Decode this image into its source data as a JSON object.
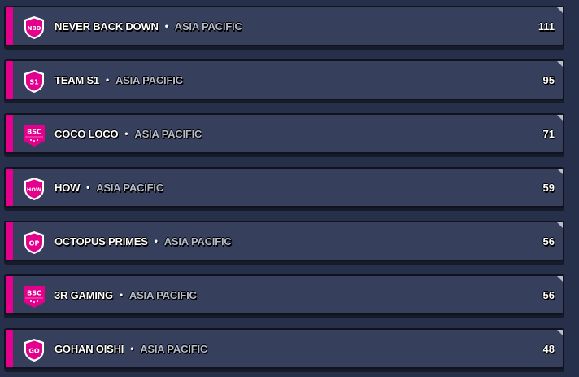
{
  "colors": {
    "accent": "#e3008c",
    "row_bg": "#363f5c",
    "page_bg": "#27304a"
  },
  "teams": [
    {
      "name": "NEVER BACK DOWN",
      "region": "ASIA PACIFIC",
      "score": "111",
      "badge_text": "NBD",
      "badge_style": "shield"
    },
    {
      "name": "TEAM S1",
      "region": "ASIA PACIFIC",
      "score": "95",
      "badge_text": "S1",
      "badge_style": "shield"
    },
    {
      "name": "COCO LOCO",
      "region": "ASIA PACIFIC",
      "score": "71",
      "badge_text": "BSC",
      "badge_style": "banner"
    },
    {
      "name": "HOW",
      "region": "ASIA PACIFIC",
      "score": "59",
      "badge_text": "HOW",
      "badge_style": "shield"
    },
    {
      "name": "OCTOPUS PRIMES",
      "region": "ASIA PACIFIC",
      "score": "56",
      "badge_text": "OP",
      "badge_style": "shield"
    },
    {
      "name": "3R GAMING",
      "region": "ASIA PACIFIC",
      "score": "56",
      "badge_text": "BSC",
      "badge_style": "banner"
    },
    {
      "name": "GOHAN OISHI",
      "region": "ASIA PACIFIC",
      "score": "48",
      "badge_text": "GO",
      "badge_style": "shield"
    }
  ],
  "separator": "•"
}
